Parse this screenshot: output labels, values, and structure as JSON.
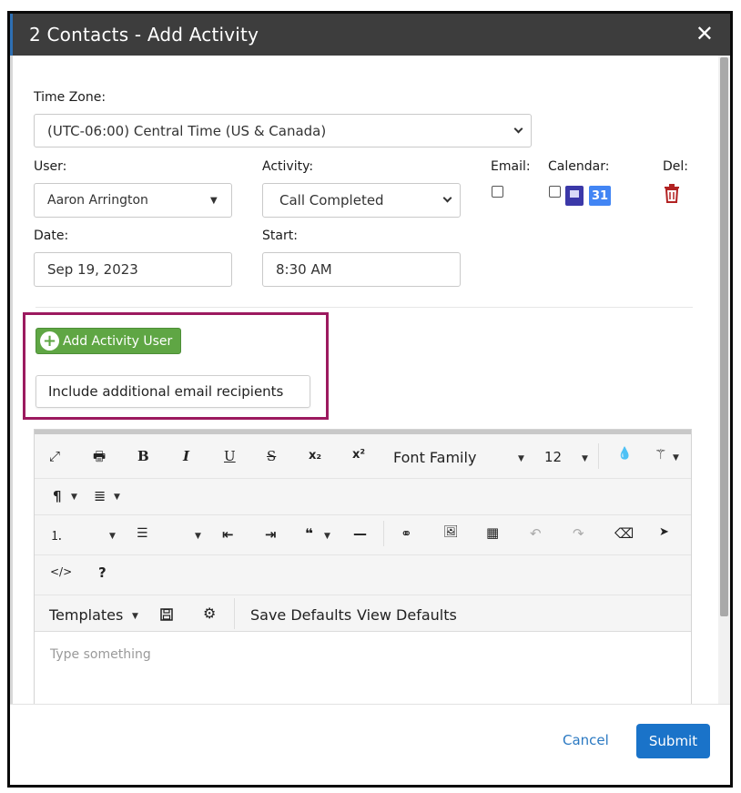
{
  "dialog": {
    "title": "2 Contacts - Add Activity",
    "close_glyph": "✕"
  },
  "form": {
    "timezone_label": "Time Zone:",
    "timezone_value": "(UTC-06:00) Central Time (US & Canada)",
    "user_label": "User:",
    "user_value": "Aaron Arrington",
    "activity_label": "Activity:",
    "activity_value": "Call Completed",
    "email_label": "Email:",
    "calendar_label": "Calendar:",
    "del_label": "Del:",
    "date_label": "Date:",
    "date_value": "Sep 19, 2023",
    "start_label": "Start:",
    "start_value": "8:30 AM",
    "email_checked": false,
    "calendar_checked": false
  },
  "actions": {
    "add_activity_user": "Add Activity User",
    "include_recipients": "Include additional email recipients"
  },
  "editor": {
    "toolbar_row1": {
      "fullscreen": "⤢",
      "print": "🖶",
      "bold": "B",
      "italic": "I",
      "underline": "U",
      "strikethrough": "S",
      "subscript": "x₂",
      "superscript": "x²",
      "font_family": "Font Family",
      "font_size": "12",
      "color": "💧",
      "magic": "⚚",
      "paragraph": "¶",
      "align": "≣"
    },
    "toolbar_row2": {
      "ordered_list": "⒈",
      "unordered_list": "☰",
      "outdent": "⇤",
      "indent": "⇥",
      "quote": "❝",
      "hr": "—",
      "link": "⚭",
      "image": "🖼",
      "table": "▦",
      "undo": "↶",
      "redo": "↷",
      "eraser": "⌫",
      "pointer": "➤",
      "code": "</>",
      "help": "?"
    },
    "toolbar_row3": {
      "templates": "Templates",
      "save_defaults": "Save Defaults",
      "view_defaults": "View Defaults"
    },
    "placeholder": "Type something"
  },
  "footer": {
    "cancel": "Cancel",
    "submit": "Submit"
  },
  "colors": {
    "titlebar": "#3d3d3d",
    "highlight_border": "#9c1a5f",
    "green_button": "#5fa644",
    "submit_button": "#1a73c9",
    "link": "#2b79c2",
    "trash": "#b22222"
  }
}
